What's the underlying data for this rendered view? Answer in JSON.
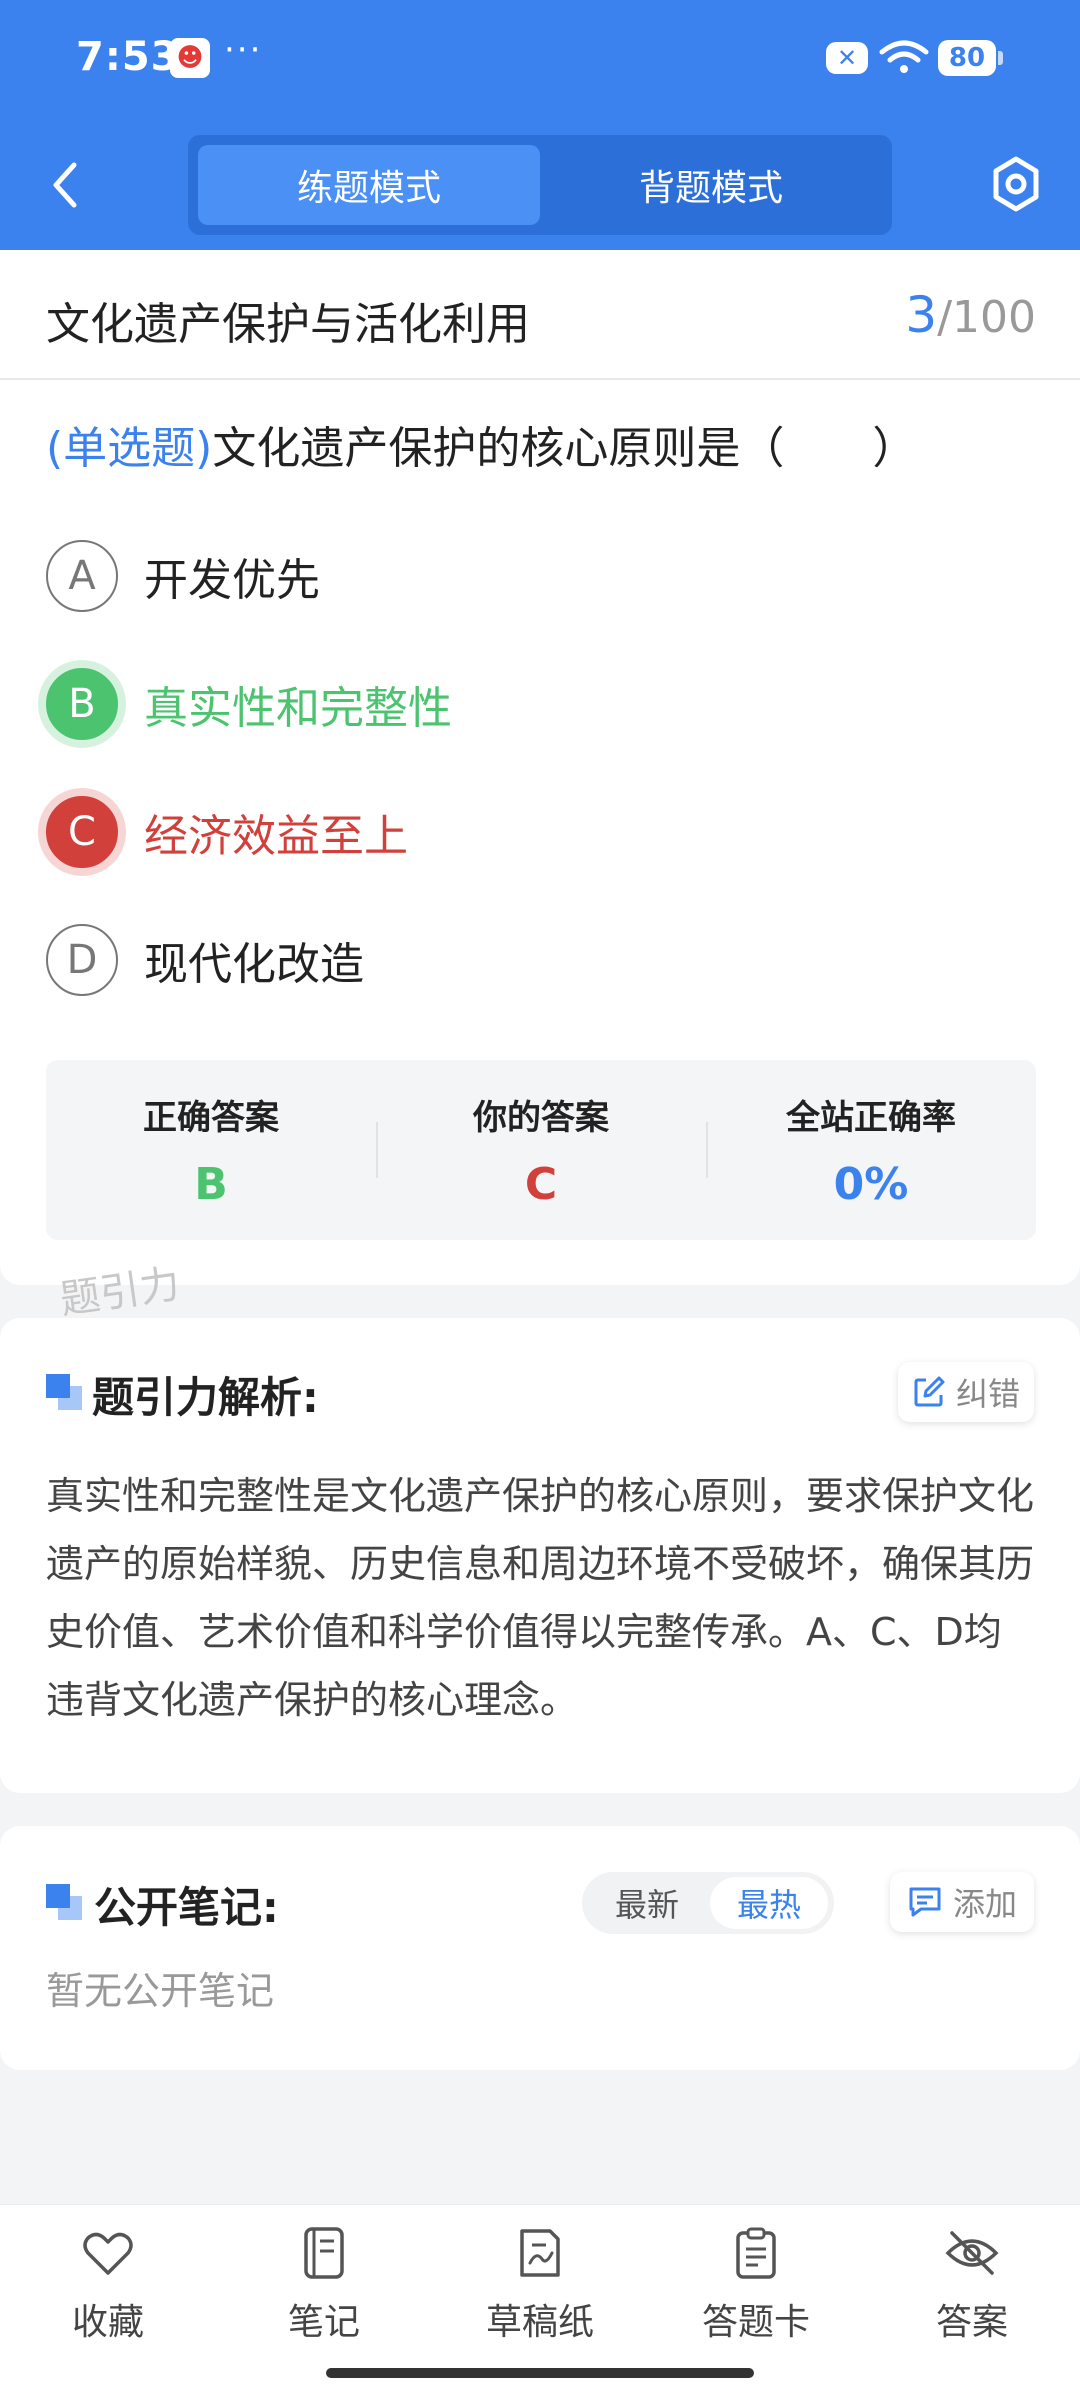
{
  "status_bar": {
    "time": "7:53",
    "more": "···",
    "battery": "80"
  },
  "header": {
    "modes": {
      "practice": "练题模式",
      "memorize": "背题模式"
    }
  },
  "quiz": {
    "section_title": "文化遗产保护与活化利用",
    "progress_current": "3",
    "progress_total": "/100",
    "question_type": "(单选题)",
    "question_text": "文化遗产保护的核心原则是（　　）",
    "options": [
      {
        "letter": "A",
        "text": "开发优先",
        "state": "normal"
      },
      {
        "letter": "B",
        "text": "真实性和完整性",
        "state": "correct"
      },
      {
        "letter": "C",
        "text": "经济效益至上",
        "state": "wrong"
      },
      {
        "letter": "D",
        "text": "现代化改造",
        "state": "normal"
      }
    ],
    "answer_summary": {
      "correct_label": "正确答案",
      "correct_value": "B",
      "yours_label": "你的答案",
      "yours_value": "C",
      "rate_label": "全站正确率",
      "rate_value": "0%"
    },
    "watermark": "题引力"
  },
  "analysis": {
    "title": "题引力解析:",
    "report_label": "纠错",
    "text": "真实性和完整性是文化遗产保护的核心原则，要求保护文化遗产的原始样貌、历史信息和周边环境不受破坏，确保其历史价值、艺术价值和科学价值得以完整传承。A、C、D均违背文化遗产保护的核心理念。"
  },
  "notes": {
    "title": "公开笔记:",
    "sort_latest": "最新",
    "sort_hot": "最热",
    "add_label": "添加",
    "empty": "暂无公开笔记"
  },
  "bottom_nav": [
    {
      "label": "收藏",
      "icon": "heart-icon"
    },
    {
      "label": "笔记",
      "icon": "notebook-icon"
    },
    {
      "label": "草稿纸",
      "icon": "draft-icon"
    },
    {
      "label": "答题卡",
      "icon": "answer-sheet-icon"
    },
    {
      "label": "答案",
      "icon": "eye-off-icon"
    }
  ],
  "colors": {
    "primary": "#3b82ef",
    "correct": "#4cc36f",
    "wrong": "#d2403b"
  }
}
